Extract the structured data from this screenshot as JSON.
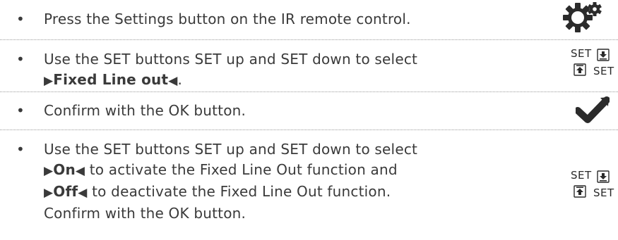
{
  "steps": [
    {
      "bullet": "•",
      "text": "Press the Settings button on the IR remote control.",
      "icon": "settings-gears-icon"
    },
    {
      "bullet": "•",
      "text_pre": "Use the SET buttons SET up and SET down to select",
      "marker_left": "▶",
      "option": "Fixed Line out",
      "marker_right": "◀",
      "text_post": ".",
      "icon": "set-up-down-icon",
      "set_label_top": "SET",
      "set_label_bottom": "SET"
    },
    {
      "bullet": "•",
      "text": "Confirm with the OK button.",
      "icon": "ok-checkmark-icon"
    },
    {
      "bullet": "•",
      "line1": "Use the SET buttons SET up and SET down to select",
      "on_left": "▶",
      "on_option": "On",
      "on_right": "◀",
      "on_text": " to activate the Fixed Line Out function and",
      "off_left": "▶",
      "off_option": "Off",
      "off_right": "◀",
      "off_text": " to deactivate the Fixed Line Out function.",
      "line4": "Confirm with the OK button.",
      "icon": "set-up-down-icon",
      "set_label_top": "SET",
      "set_label_bottom": "SET"
    }
  ]
}
